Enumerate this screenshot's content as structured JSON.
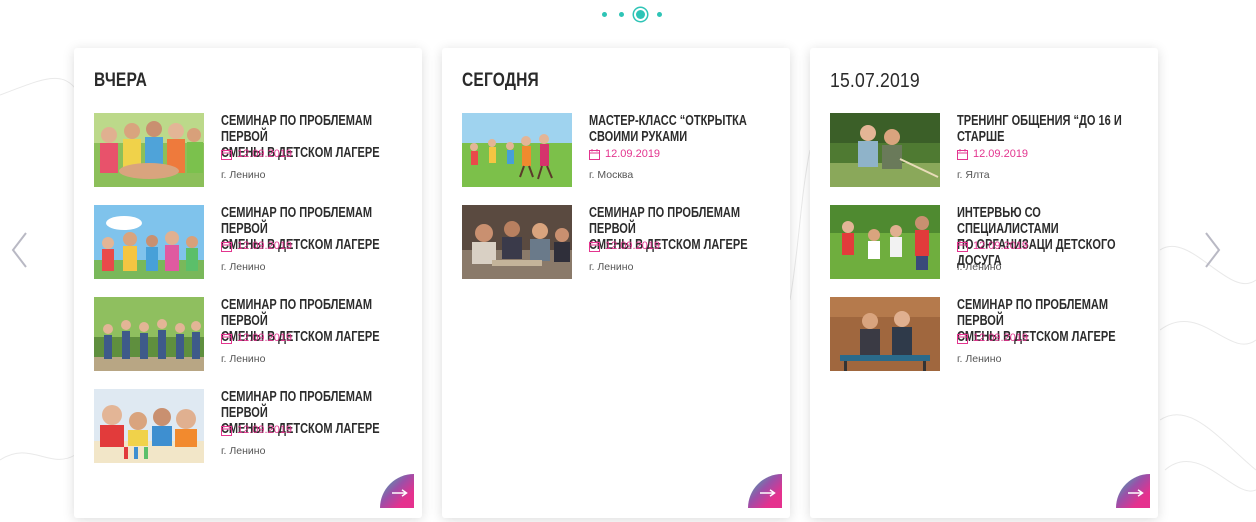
{
  "carousel": {
    "dots_count": 4,
    "active_dot_index": 2,
    "accent_color": "#2ec4b6",
    "date_color": "#e3358f"
  },
  "columns": [
    {
      "heading": "ВЧЕРА",
      "events": [
        {
          "title": "СЕМИНАР ПО ПРОБЛЕМАМ  ПЕРВОЙ\nСМЕНЫ В ДЕТСКОМ ЛАГЕРЕ",
          "date": "12.09.2019",
          "location": "г. Ленино",
          "image_icon": "children-group-photo"
        },
        {
          "title": "СЕМИНАР ПО ПРОБЛЕМАМ  ПЕРВОЙ\nСМЕНЫ В ДЕТСКОМ ЛАГЕРЕ",
          "date": "12.09.2019",
          "location": "г. Ленино",
          "image_icon": "children-outdoors-photo"
        },
        {
          "title": "СЕМИНАР ПО ПРОБЛЕМАМ  ПЕРВОЙ\nСМЕНЫ В ДЕТСКОМ ЛАГЕРЕ",
          "date": "12.09.2019",
          "location": "г. Ленино",
          "image_icon": "children-park-photo"
        },
        {
          "title": "СЕМИНАР ПО ПРОБЛЕМАМ  ПЕРВОЙ\nСМЕНЫ В ДЕТСКОМ ЛАГЕРЕ",
          "date": "12.09.2019",
          "location": "г. Ленино",
          "image_icon": "children-drawing-photo"
        }
      ]
    },
    {
      "heading": "СЕГОДНЯ",
      "events": [
        {
          "title": "МАСТЕР-КЛАСС “ОТКРЫТКА\nСВОИМИ РУКАМИ",
          "date": "12.09.2019",
          "location": "г. Москва",
          "image_icon": "children-running-photo"
        },
        {
          "title": "СЕМИНАР ПО ПРОБЛЕМАМ  ПЕРВОЙ\nСМЕНЫ В ДЕТСКОМ ЛАГЕРЕ",
          "date": "12.09.2019",
          "location": "г. Ленино",
          "image_icon": "workshop-photo"
        }
      ]
    },
    {
      "heading": "15.07.2019",
      "events": [
        {
          "title": "ТРЕНИНГ ОБЩЕНИЯ “ДО 16 И\nСТАРШЕ",
          "date": "12.09.2019",
          "location": "г. Ялта",
          "image_icon": "kids-rope-pull-photo"
        },
        {
          "title": "ИНТЕРВЬЮ СО  СПЕЦИАЛИСТАМИ\nПО ОРГАНИЗАЦИ ДЕТСКОГО ДОСУГА",
          "date": "12.09.2019",
          "location": "г. Ленино",
          "image_icon": "children-field-photo"
        },
        {
          "title": "СЕМИНАР ПО ПРОБЛЕМАМ  ПЕРВОЙ\nСМЕНЫ В ДЕТСКОМ ЛАГЕРЕ",
          "date": "12.09.2019",
          "location": "г. Ленино",
          "image_icon": "teens-table-tennis-photo"
        }
      ]
    }
  ],
  "icons": {
    "prev": "chevron-left-icon",
    "next": "chevron-right-icon",
    "date": "calendar-icon",
    "more": "arrow-right-icon"
  }
}
